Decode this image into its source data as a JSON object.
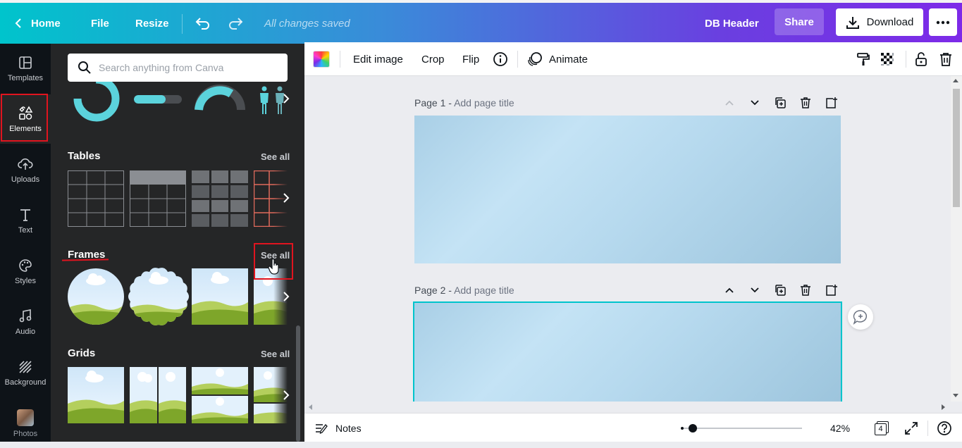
{
  "topbar": {
    "home_label": "Home",
    "file_label": "File",
    "resize_label": "Resize",
    "status_text": "All changes saved",
    "design_title": "DB Header",
    "share_label": "Share",
    "download_label": "Download"
  },
  "rail": {
    "items": [
      {
        "label": "Templates",
        "icon": "templates-icon"
      },
      {
        "label": "Elements",
        "icon": "elements-icon"
      },
      {
        "label": "Uploads",
        "icon": "uploads-icon"
      },
      {
        "label": "Text",
        "icon": "text-icon"
      },
      {
        "label": "Styles",
        "icon": "styles-icon"
      },
      {
        "label": "Audio",
        "icon": "audio-icon"
      },
      {
        "label": "Background",
        "icon": "background-icon"
      },
      {
        "label": "Photos",
        "icon": "photos-icon"
      }
    ],
    "active": "Elements"
  },
  "panel": {
    "search_placeholder": "Search anything from Canva",
    "sections": [
      {
        "title": "Tables",
        "see_all": "See all"
      },
      {
        "title": "Frames",
        "see_all": "See all"
      },
      {
        "title": "Grids",
        "see_all": "See all"
      }
    ]
  },
  "toolbar": {
    "edit_image": "Edit image",
    "crop": "Crop",
    "flip": "Flip",
    "animate": "Animate"
  },
  "pages": [
    {
      "number_label": "Page 1 -",
      "title_placeholder": "Add page title"
    },
    {
      "number_label": "Page 2 -",
      "title_placeholder": "Add page title"
    }
  ],
  "bottombar": {
    "notes_label": "Notes",
    "zoom": "42%",
    "page_count": "4",
    "zoom_fraction": 0.05
  },
  "colors": {
    "brand_gradient_start": "#00c4cc",
    "brand_gradient_end": "#7d2ae8",
    "highlight_red": "#e0141f",
    "selection_cyan": "#00c4cc",
    "frame_shape_teal": "#5bd3dc"
  }
}
